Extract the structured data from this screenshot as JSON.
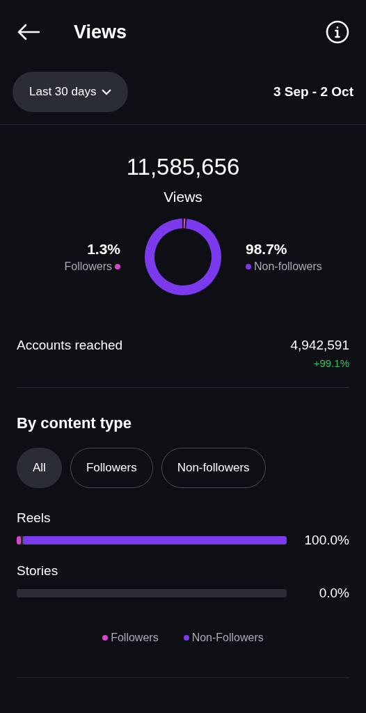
{
  "header": {
    "title": "Views"
  },
  "filter": {
    "label": "Last 30 days",
    "range": "3 Sep - 2 Oct"
  },
  "summary": {
    "total": "11,585,656",
    "label": "Views",
    "left": {
      "percent": "1.3%",
      "color": "#d946c9"
    },
    "right": {
      "percent": "98.7%",
      "color": "#7c3aed"
    },
    "chart_data": {
      "type": "donut",
      "categories": [
        "Followers",
        "Non-followers"
      ],
      "values": [
        1.3,
        98.7
      ]
    }
  },
  "accounts_reached": {
    "label": "Accounts reached",
    "value": "4,942,591",
    "change": "+99.1%"
  },
  "content_type": {
    "title": "By content type",
    "chips": [
      {
        "label": "All",
        "selected": true
      },
      {
        "label": "Followers",
        "selected": false
      },
      {
        "label": "Non-followers",
        "selected": false
      }
    ],
    "rows": [
      {
        "name": "Reels",
        "percent": "100.0%",
        "segments": [
          {
            "level": 0.013
          },
          {
            "level": 0.987
          }
        ]
      },
      {
        "name": "Stories",
        "percent": "0.0%"
      }
    ],
    "legend": [
      {
        "label": "Followers",
        "color": "#d946c9"
      },
      {
        "label": "Non-Followers",
        "color": "#7c3aed"
      }
    ]
  }
}
